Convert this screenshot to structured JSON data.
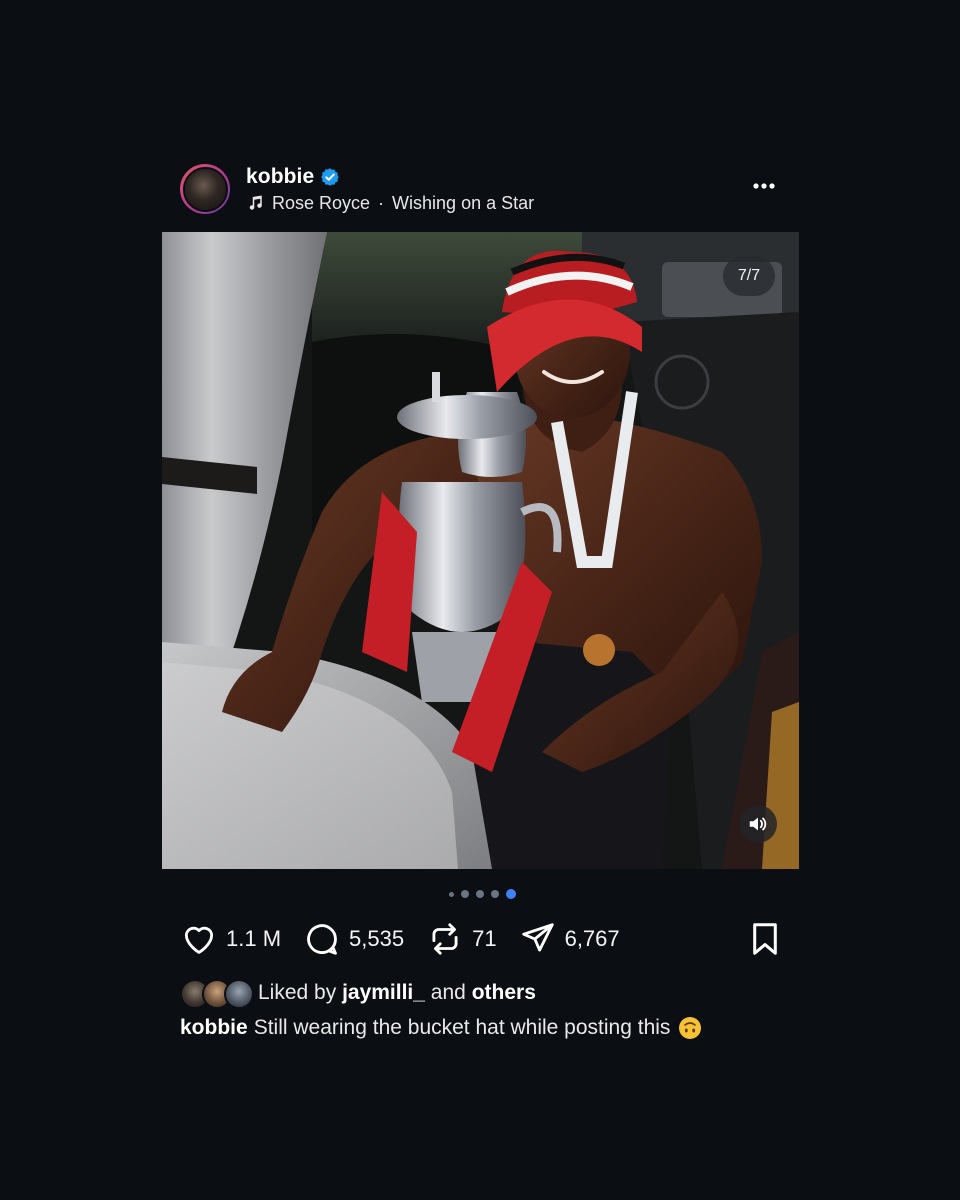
{
  "post": {
    "username": "kobbie",
    "verified": true,
    "music": {
      "artist": "Rose Royce",
      "separator": "·",
      "title": "Wishing on a Star"
    },
    "media": {
      "counter": "7/7",
      "description_icon": "photo",
      "carousel": {
        "total_dots": 5,
        "active_index": 4
      }
    },
    "actions": {
      "likes": "1.1 M",
      "comments": "5,535",
      "reposts": "71",
      "shares": "6,767"
    },
    "liked_by": {
      "prefix": "Liked by",
      "user": "jaymilli_",
      "conjunction": "and",
      "others": "others"
    },
    "caption": {
      "username": "kobbie",
      "text": "Still wearing the bucket hat while posting this"
    }
  },
  "colors": {
    "background": "#0b0e12",
    "text": "#f2f3f5",
    "verified": "#1d9bf0",
    "active_dot": "#3c82f6",
    "inactive_dot": "#6c7480"
  },
  "icons": [
    "more-icon",
    "music-note-icon",
    "verified-badge-icon",
    "heart-icon",
    "comment-icon",
    "repost-icon",
    "share-icon",
    "bookmark-icon",
    "sound-icon"
  ]
}
